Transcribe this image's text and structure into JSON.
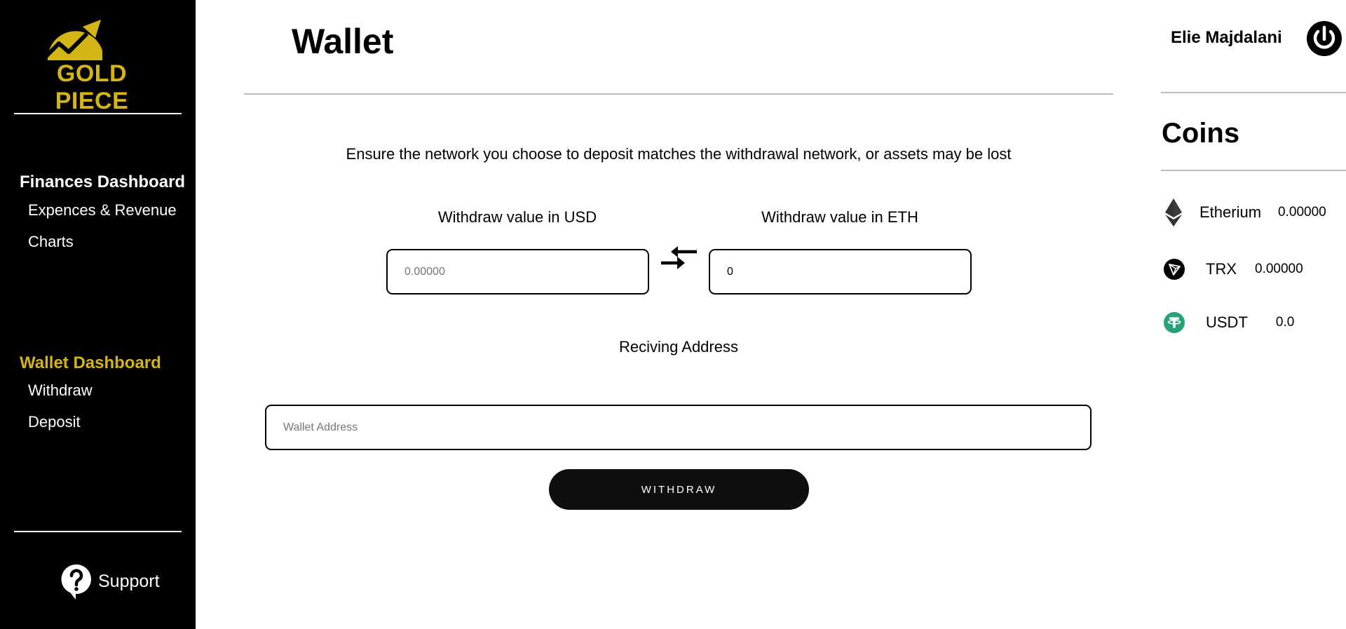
{
  "brand": {
    "name": "GOLD PIECE",
    "color": "#d4b516"
  },
  "sidebar": {
    "sections": [
      {
        "heading": "Finances Dashboard",
        "heading_color": "#ffffff",
        "items": [
          "Expences & Revenue",
          "Charts"
        ]
      },
      {
        "heading": "Wallet Dashboard",
        "heading_color": "#d4b516",
        "items": [
          "Withdraw",
          "Deposit"
        ]
      }
    ],
    "support_label": "Support",
    "support_icon": "question-bubble-icon"
  },
  "header": {
    "title": "Wallet",
    "user_name": "Elie Majdalani",
    "logout_icon": "power-icon"
  },
  "withdraw": {
    "notice": "Ensure the network you choose to deposit matches the withdrawal network, or assets may be lost",
    "usd_label": "Withdraw value in USD",
    "usd_placeholder": "0.00000",
    "eth_label": "Withdraw value in ETH",
    "eth_value": "0",
    "swap_icon": "swap-arrows-icon",
    "address_label": "Reciving Address",
    "address_placeholder": "Wallet Address",
    "button_label": "WITHDRAW"
  },
  "coins": {
    "title": "Coins",
    "items": [
      {
        "name": "Etherium",
        "value": "0.00000",
        "icon": "ethereum-icon"
      },
      {
        "name": "TRX",
        "value": "0.00000",
        "icon": "tron-icon"
      },
      {
        "name": "USDT",
        "value": "0.0",
        "icon": "tether-icon",
        "icon_color": "#26a17b"
      }
    ]
  }
}
